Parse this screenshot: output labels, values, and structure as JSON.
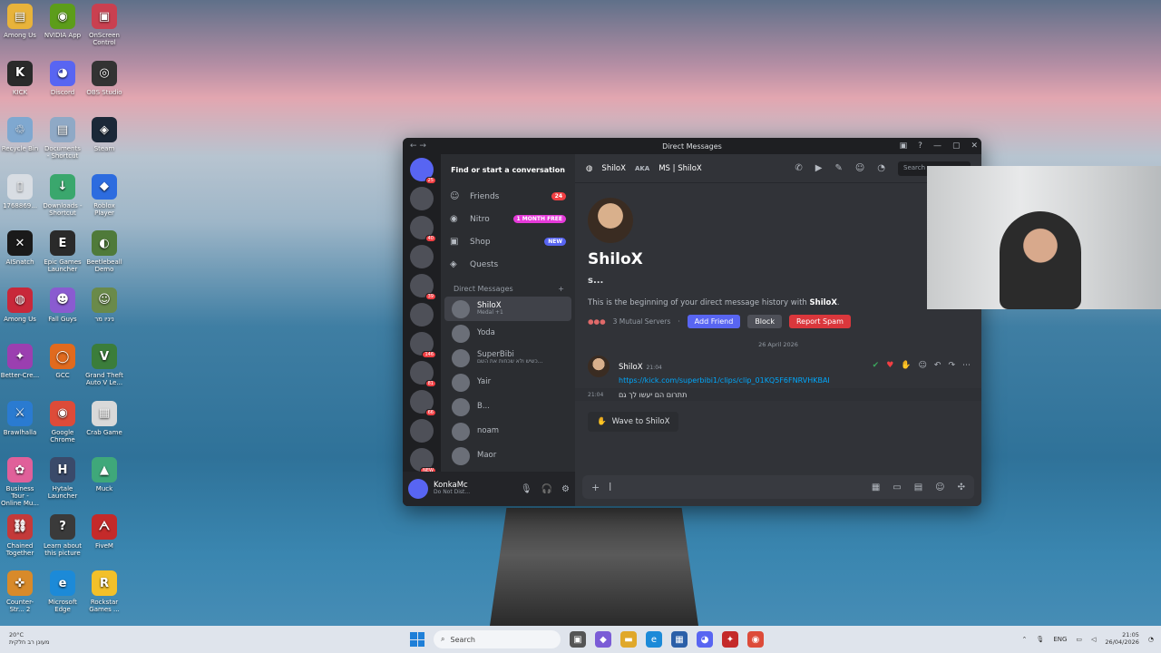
{
  "desktop": {
    "icons": [
      {
        "label": "Among Us",
        "color": "#e8b33a",
        "glyph": "▤"
      },
      {
        "label": "NVIDIA App",
        "color": "#5c9d1a",
        "glyph": "◉"
      },
      {
        "label": "OnScreen Control",
        "color": "#c94050",
        "glyph": "▣"
      },
      {
        "label": "KICK",
        "color": "#2a2a2a",
        "glyph": "K"
      },
      {
        "label": "Discord",
        "color": "#5865f2",
        "glyph": "◕"
      },
      {
        "label": "OBS Studio",
        "color": "#333333",
        "glyph": "◎"
      },
      {
        "label": "Recycle Bin",
        "color": "#7fa8d0",
        "glyph": "♲"
      },
      {
        "label": "Documents - Shortcut",
        "color": "#8fa9c6",
        "glyph": "▤"
      },
      {
        "label": "Steam",
        "color": "#1b2838",
        "glyph": "◈"
      },
      {
        "label": "1768869...",
        "color": "#d8dde3",
        "glyph": "▯"
      },
      {
        "label": "Downloads - Shortcut",
        "color": "#3aa76d",
        "glyph": "↓"
      },
      {
        "label": "Roblox Player",
        "color": "#2d6cdf",
        "glyph": "◆"
      },
      {
        "label": "AISnatch",
        "color": "#1a1a1a",
        "glyph": "✕"
      },
      {
        "label": "Epic Games Launcher",
        "color": "#2a2a2a",
        "glyph": "E"
      },
      {
        "label": "Beetlebeall Demo",
        "color": "#4f7a3a",
        "glyph": "◐"
      },
      {
        "label": "Among Us",
        "color": "#c8283a",
        "glyph": "◍"
      },
      {
        "label": "Fall Guys",
        "color": "#8a5bd0",
        "glyph": "☻"
      },
      {
        "label": "ניניו מר",
        "color": "#6a8a4a",
        "glyph": "☺"
      },
      {
        "label": "Better-Cre...",
        "color": "#9b3fb0",
        "glyph": "✦"
      },
      {
        "label": "GCC",
        "color": "#e06a1e",
        "glyph": "◯"
      },
      {
        "label": "Grand Theft Auto V Le...",
        "color": "#3b7d3b",
        "glyph": "V"
      },
      {
        "label": "Brawlhalla",
        "color": "#2a7bd1",
        "glyph": "⚔"
      },
      {
        "label": "Google Chrome",
        "color": "#dd4b39",
        "glyph": "◉"
      },
      {
        "label": "Crab Game",
        "color": "#d9d9d9",
        "glyph": "▦"
      },
      {
        "label": "Business Tour - Online Mu...",
        "color": "#e0609a",
        "glyph": "✿"
      },
      {
        "label": "Hytale Launcher",
        "color": "#3a4a6a",
        "glyph": "H"
      },
      {
        "label": "Muck",
        "color": "#3fa87a",
        "glyph": "▲"
      },
      {
        "label": "Chained Together",
        "color": "#c43a3a",
        "glyph": "⛓"
      },
      {
        "label": "Learn about this picture",
        "color": "#3a3a3a",
        "glyph": "?"
      },
      {
        "label": "FiveM",
        "color": "#c42a2a",
        "glyph": "ᗅ"
      },
      {
        "label": "Counter-Str... 2",
        "color": "#d88a2a",
        "glyph": "✜"
      },
      {
        "label": "Microsoft Edge",
        "color": "#1c8ad8",
        "glyph": "e"
      },
      {
        "label": "Rockstar Games ...",
        "color": "#f2c02a",
        "glyph": "R"
      }
    ]
  },
  "window": {
    "title": "Direct Messages",
    "minimize": "—",
    "maximize": "▢",
    "close": "✕"
  },
  "servers": [
    {
      "badge": "25"
    },
    {
      "badge": ""
    },
    {
      "badge": "40"
    },
    {
      "badge": ""
    },
    {
      "badge": "39"
    },
    {
      "badge": ""
    },
    {
      "badge": "146"
    },
    {
      "badge": "81"
    },
    {
      "badge": "66"
    },
    {
      "badge": ""
    },
    {
      "badge": "NEW"
    }
  ],
  "sidebar": {
    "find_label": "Find or start a conversation",
    "nav": [
      {
        "label": "Friends",
        "icon": "friends-icon",
        "glyph": "☺",
        "pill": "24",
        "pill_color": "#f23f43"
      },
      {
        "label": "Nitro",
        "icon": "nitro-icon",
        "glyph": "◉",
        "pill": "1 MONTH FREE",
        "pill_color": "#e53ad9"
      },
      {
        "label": "Shop",
        "icon": "shop-icon",
        "glyph": "▣",
        "pill": "NEW",
        "pill_color": "#5865f2"
      },
      {
        "label": "Quests",
        "icon": "quests-icon",
        "glyph": "◈",
        "pill": "",
        "pill_color": ""
      }
    ],
    "dm_header": "Direct Messages",
    "dm_add": "+",
    "dms": [
      {
        "name": "ShiloX",
        "sub": "Medal +1",
        "active": true
      },
      {
        "name": "Yoda",
        "sub": "",
        "active": false
      },
      {
        "name": "SuperBibi",
        "sub": "כשיש ולא שכחות את השם...",
        "active": false
      },
      {
        "name": "Yair",
        "sub": "",
        "active": false
      },
      {
        "name": "B...",
        "sub": "",
        "active": false
      },
      {
        "name": "noam",
        "sub": "",
        "active": false
      },
      {
        "name": "Maor",
        "sub": "",
        "active": false
      }
    ]
  },
  "user": {
    "name": "KonkaMc",
    "status": "Do Not Dist..."
  },
  "chat": {
    "header_name": "ShiloX",
    "aka_label": "AKA",
    "aka_value": "MS | ShiloX",
    "search_placeholder": "Search s...",
    "intro_name": "ShiloX",
    "intro_username": "s...",
    "intro_text_prefix": "This is the beginning of your direct message history with",
    "intro_text_name": "ShiloX",
    "intro_text_suffix": ".",
    "mutual": "3 Mutual Servers",
    "add_friend": "Add Friend",
    "block": "Block",
    "report": "Report Spam",
    "date_divider": "26 April 2026",
    "messages": [
      {
        "author": "ShiloX",
        "time": "21:04",
        "text": "https://kick.com/superbibi1/clips/clip_01KQ5F6FNRVHKBAI"
      },
      {
        "author": "",
        "time": "21:04",
        "text": "תתרום הם יעשו לך גם"
      }
    ],
    "wave": "Wave to ShiloX",
    "composer_value": "|"
  },
  "taskbar": {
    "weather_temp": "20°C",
    "weather_text": "מעונן רב חלקית",
    "search_label": "Search",
    "lang": "ENG",
    "time": "21:05",
    "date": "26/04/2026"
  },
  "colors": {
    "accent": "#5865f2",
    "danger": "#da373c",
    "link": "#00a8fc"
  }
}
